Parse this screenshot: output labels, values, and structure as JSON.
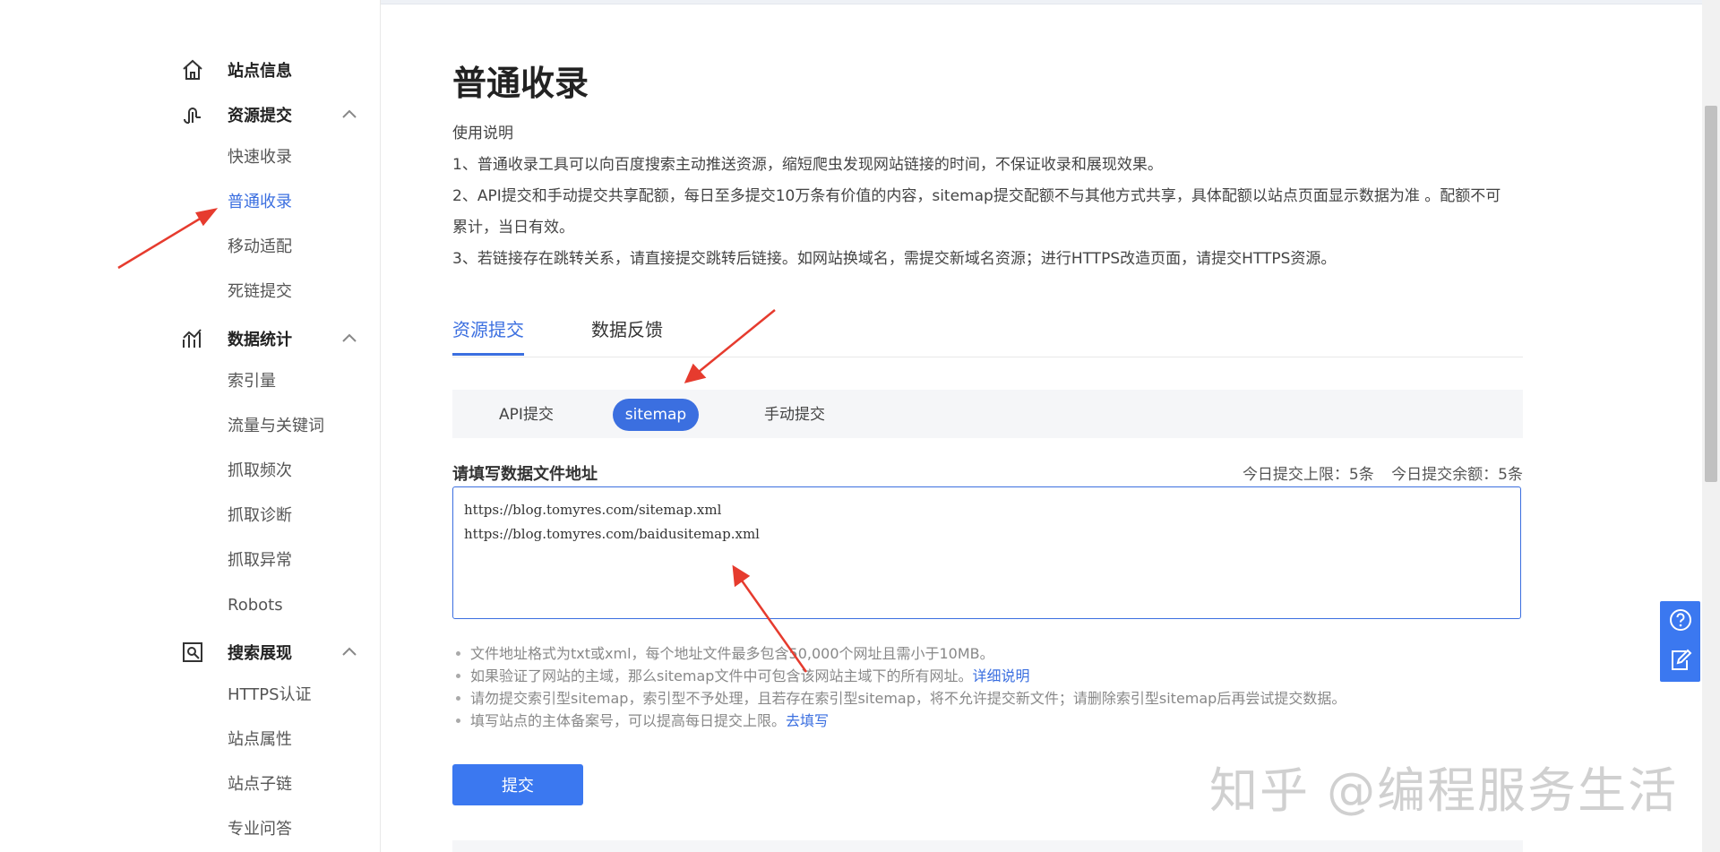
{
  "sidebar": {
    "groups": [
      {
        "label": "站点信息",
        "icon": "home-icon"
      },
      {
        "label": "资源提交",
        "icon": "submit-icon",
        "items": [
          "快速收录",
          "普通收录",
          "移动适配",
          "死链提交"
        ]
      },
      {
        "label": "数据统计",
        "icon": "stats-icon",
        "items": [
          "索引量",
          "流量与关键词",
          "抓取频次",
          "抓取诊断",
          "抓取异常",
          "Robots"
        ]
      },
      {
        "label": "搜索展现",
        "icon": "search-display-icon",
        "items": [
          "HTTPS认证",
          "站点属性",
          "站点子链",
          "专业问答"
        ]
      }
    ],
    "active_item": "普通收录"
  },
  "main": {
    "title": "普通收录",
    "instructions": {
      "heading": "使用说明",
      "lines": [
        "1、普通收录工具可以向百度搜索主动推送资源，缩短爬虫发现网站链接的时间，不保证收录和展现效果。",
        "2、API提交和手动提交共享配额，每日至多提交10万条有价值的内容，sitemap提交配额不与其他方式共享，具体配额以站点页面显示数据为准 。配额不可",
        "累计，当日有效。",
        "3、若链接存在跳转关系，请直接提交跳转后链接。如网站换域名，需提交新域名资源；进行HTTPS改造页面，请提交HTTPS资源。"
      ]
    },
    "tabs": [
      "资源提交",
      "数据反馈"
    ],
    "active_tab": "资源提交",
    "subtabs": [
      "API提交",
      "sitemap",
      "手动提交"
    ],
    "active_subtab": "sitemap",
    "form": {
      "label": "请填写数据文件地址",
      "quota_limit": "今日提交上限：5条",
      "quota_remaining": "今日提交余额：5条",
      "urls": [
        "https://blog.tomyres.com/sitemap.xml",
        "https://blog.tomyres.com/baidusitemap.xml"
      ]
    },
    "tips": [
      {
        "text": "文件地址格式为txt或xml，每个地址文件最多包含50,000个网址且需小于10MB。",
        "link": ""
      },
      {
        "text": "如果验证了网站的主域，那么sitemap文件中可包含该网站主域下的所有网址。",
        "link": "详细说明"
      },
      {
        "text": "请勿提交索引型sitemap，索引型不予处理，且若存在索引型sitemap，将不允许提交新文件；请删除索引型sitemap后再尝试提交数据。",
        "link": ""
      },
      {
        "text": "填写站点的主体备案号，可以提高每日提交上限。",
        "link": "去填写"
      }
    ],
    "submit_label": "提交"
  },
  "float_buttons": [
    "help-icon",
    "feedback-icon"
  ],
  "watermark": "知乎 @编程服务生活",
  "colors": {
    "accent": "#3b6fe0",
    "annotation": "#e63b2e"
  }
}
